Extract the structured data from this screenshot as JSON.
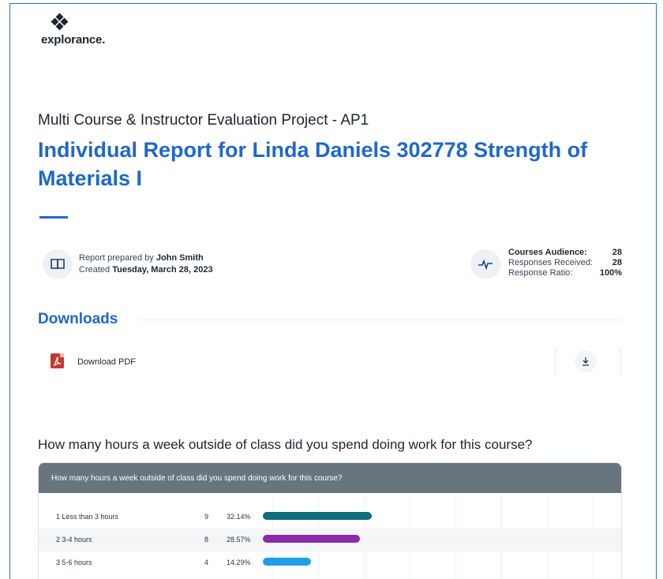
{
  "logo": {
    "wordmark": "explorance."
  },
  "project_title": "Multi Course & Instructor Evaluation Project - AP1",
  "report_title": "Individual Report for Linda Daniels 302778 Strength of Materials I",
  "meta": {
    "prepared_prefix": "Report prepared by ",
    "prepared_by": "John Smith",
    "created_prefix": "Created ",
    "created_date": "Tuesday, March 28, 2023"
  },
  "stats": [
    {
      "label": "Courses Audience:",
      "value": "28"
    },
    {
      "label": "Responses Received:",
      "value": "28"
    },
    {
      "label": "Response Ratio:",
      "value": "100%"
    }
  ],
  "downloads": {
    "heading": "Downloads",
    "item_label": "Download PDF"
  },
  "question": {
    "heading": "How many hours a week outside of class did you spend doing work for this course?",
    "table_title": "How many hours a week outside of class did you spend doing work for this course?",
    "rows": [
      {
        "label": "1 Less than 3 hours",
        "count": "9",
        "percent": "32.14%",
        "value": 32.14,
        "color": "#0e6e7e"
      },
      {
        "label": "2 3-4 hours",
        "count": "8",
        "percent": "28.57%",
        "value": 28.57,
        "color": "#8a2aa6"
      },
      {
        "label": "3 5-6 hours",
        "count": "4",
        "percent": "14.29%",
        "value": 14.29,
        "color": "#1ea0e8"
      }
    ]
  },
  "colors": {
    "accent": "#1f68c8",
    "header_bar": "#68757f",
    "pdf": "#c8372d"
  }
}
